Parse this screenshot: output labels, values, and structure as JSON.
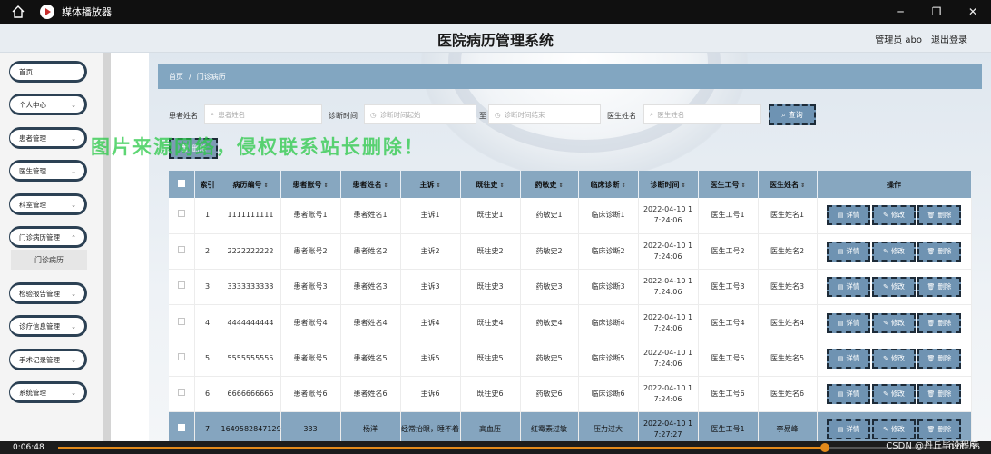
{
  "player": {
    "title": "媒体播放器",
    "time_current": "0:06:48",
    "time_total": "0:00:56",
    "progress": 0.862
  },
  "header": {
    "title": "医院病历管理系统",
    "user": "管理员 abo",
    "logout": "退出登录"
  },
  "sidebar": {
    "items": [
      {
        "label": "首页"
      },
      {
        "label": "个人中心"
      },
      {
        "label": "患者管理"
      },
      {
        "label": "医生管理"
      },
      {
        "label": "科室管理"
      },
      {
        "label": "门诊病历管理"
      },
      {
        "label": "检验报告管理"
      },
      {
        "label": "诊疗信息管理"
      },
      {
        "label": "手术记录管理"
      },
      {
        "label": "系统管理"
      }
    ],
    "sub_item": "门诊病历"
  },
  "breadcrumb": {
    "home": "首页",
    "sep": "/",
    "current": "门诊病历"
  },
  "search": {
    "patient_name_label": "患者姓名",
    "patient_name_placeholder": "患者姓名",
    "diag_time_label": "诊断时间",
    "diag_start_placeholder": "诊断时间起始",
    "to_label": "至",
    "diag_end_placeholder": "诊断时间结束",
    "doctor_name_label": "医生姓名",
    "doctor_name_placeholder": "医生姓名",
    "query_label": "查询",
    "delete_label": "删除"
  },
  "watermark": "图片来源网络，侵权联系站长删除！",
  "table": {
    "headers": [
      "",
      "索引",
      "病历编号",
      "患者账号",
      "患者姓名",
      "主诉",
      "既往史",
      "药敏史",
      "临床诊断",
      "诊断时间",
      "医生工号",
      "医生姓名",
      "操作"
    ],
    "actions": {
      "detail": "详情",
      "edit": "修改",
      "delete": "删除"
    },
    "rows": [
      {
        "idx": "1",
        "record": "1111111111",
        "account": "患者账号1",
        "name": "患者姓名1",
        "complaint": "主诉1",
        "history": "既往史1",
        "allergy": "药敏史1",
        "diagnosis": "临床诊断1",
        "time_a": "2022-04-10 1",
        "time_b": "7:24:06",
        "doc_no": "医生工号1",
        "doc_name": "医生姓名1"
      },
      {
        "idx": "2",
        "record": "2222222222",
        "account": "患者账号2",
        "name": "患者姓名2",
        "complaint": "主诉2",
        "history": "既往史2",
        "allergy": "药敏史2",
        "diagnosis": "临床诊断2",
        "time_a": "2022-04-10 1",
        "time_b": "7:24:06",
        "doc_no": "医生工号2",
        "doc_name": "医生姓名2"
      },
      {
        "idx": "3",
        "record": "3333333333",
        "account": "患者账号3",
        "name": "患者姓名3",
        "complaint": "主诉3",
        "history": "既往史3",
        "allergy": "药敏史3",
        "diagnosis": "临床诊断3",
        "time_a": "2022-04-10 1",
        "time_b": "7:24:06",
        "doc_no": "医生工号3",
        "doc_name": "医生姓名3"
      },
      {
        "idx": "4",
        "record": "4444444444",
        "account": "患者账号4",
        "name": "患者姓名4",
        "complaint": "主诉4",
        "history": "既往史4",
        "allergy": "药敏史4",
        "diagnosis": "临床诊断4",
        "time_a": "2022-04-10 1",
        "time_b": "7:24:06",
        "doc_no": "医生工号4",
        "doc_name": "医生姓名4"
      },
      {
        "idx": "5",
        "record": "5555555555",
        "account": "患者账号5",
        "name": "患者姓名5",
        "complaint": "主诉5",
        "history": "既往史5",
        "allergy": "药敏史5",
        "diagnosis": "临床诊断5",
        "time_a": "2022-04-10 1",
        "time_b": "7:24:06",
        "doc_no": "医生工号5",
        "doc_name": "医生姓名5"
      },
      {
        "idx": "6",
        "record": "6666666666",
        "account": "患者账号6",
        "name": "患者姓名6",
        "complaint": "主诉6",
        "history": "既往史6",
        "allergy": "药敏史6",
        "diagnosis": "临床诊断6",
        "time_a": "2022-04-10 1",
        "time_b": "7:24:06",
        "doc_no": "医生工号6",
        "doc_name": "医生姓名6"
      },
      {
        "idx": "7",
        "record": "1649582847129",
        "account": "333",
        "name": "杨洋",
        "complaint": "经常抬眼，睡不着",
        "history": "高血压",
        "allergy": "红霉素过敏",
        "diagnosis": "压力过大",
        "time_a": "2022-04-10 1",
        "time_b": "7:27:27",
        "doc_no": "医生工号1",
        "doc_name": "李易峰"
      }
    ]
  },
  "csdn": "CSDN @丹丘毕设程序"
}
